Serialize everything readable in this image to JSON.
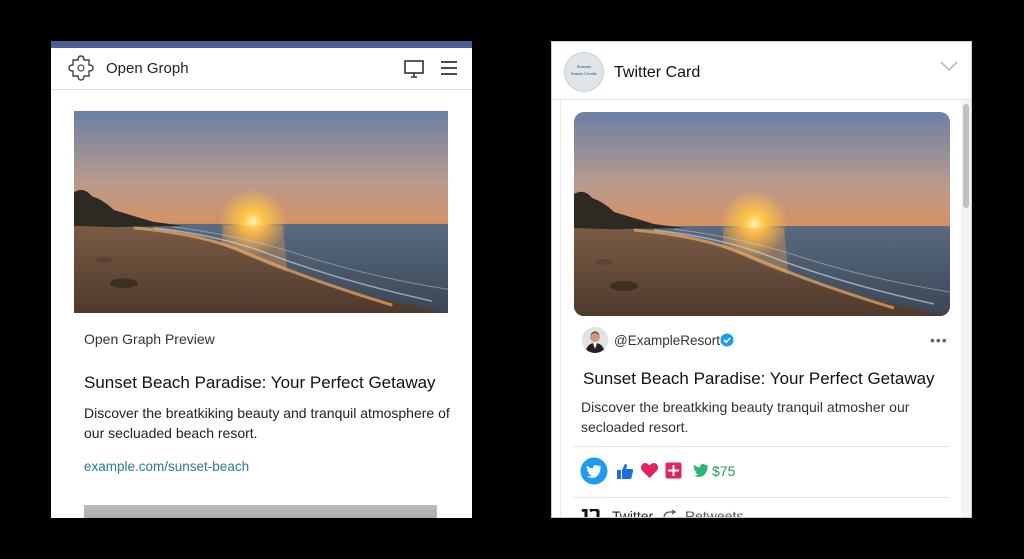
{
  "og": {
    "app_title": "Open Groph",
    "caption": "Open Graph Preview",
    "heading": "Sunset Beach Paradise: Your Perfect Getaway",
    "description": "Discover the breatkiking beauty and tranquil atmosphere of our secluaded beach resort.",
    "link": "example.com/sunset-beach",
    "accent_color": "#4a5f97",
    "link_color": "#2a7c92"
  },
  "tw": {
    "card_title": "Twitter Card",
    "avatar_line1": "Sunsnet",
    "avatar_line2": "Sunets Cerahe",
    "handle": "@ExampleResort",
    "heading": "Sunset Beach Paradise: Your Perfect Getaway",
    "description": "Discover the breatkking beauty tranquil atmosher our secloaded resort.",
    "price": "$75",
    "footer_label": "Twitter",
    "footer_retweets": "Retweets",
    "verified_color": "#1d9bf0",
    "price_color": "#2b9a4a"
  },
  "icons": [
    "puzzle-logo-icon",
    "monitor-icon",
    "hamburger-menu-icon",
    "chevron-down-icon",
    "verified-badge-icon",
    "more-icon",
    "twitter-bird-icon",
    "thumbs-up-icon",
    "heart-icon",
    "plus-icon",
    "retweet-icon"
  ]
}
